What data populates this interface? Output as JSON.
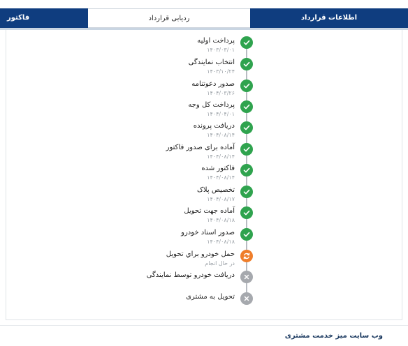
{
  "tabs": {
    "info": "اطلاعات قرارداد",
    "tracking": "ردیابی قرارداد",
    "invoice": "فاکتور"
  },
  "steps": [
    {
      "title": "پرداخت اولیه",
      "date": "۱۴۰۳/۰۳/۰۱",
      "status": "done"
    },
    {
      "title": "انتخاب نمایندگی",
      "date": "۱۴۰۳/۱۰/۲۴",
      "status": "done"
    },
    {
      "title": "صدور دعوتنامه",
      "date": "۱۴۰۴/۰۳/۲۶",
      "status": "done"
    },
    {
      "title": "پرداخت کل وجه",
      "date": "۱۴۰۴/۰۴/۰۱",
      "status": "done"
    },
    {
      "title": "دریافت پرونده",
      "date": "۱۴۰۴/۰۸/۱۴",
      "status": "done"
    },
    {
      "title": "آماده برای صدور فاکتور",
      "date": "۱۴۰۴/۰۸/۱۴",
      "status": "done"
    },
    {
      "title": "فاکتور شده",
      "date": "۱۴۰۴/۰۸/۱۴",
      "status": "done"
    },
    {
      "title": "تخصیص پلاک",
      "date": "۱۴۰۴/۰۸/۱۷",
      "status": "done"
    },
    {
      "title": "آماده جهت تحویل",
      "date": "۱۴۰۴/۰۸/۱۸",
      "status": "done"
    },
    {
      "title": "صدور اسناد خودرو",
      "date": "۱۴۰۴/۰۸/۱۸",
      "status": "done"
    },
    {
      "title": "حمل خودرو براي تحويل",
      "date": "در حال انجام",
      "status": "in-progress"
    },
    {
      "title": "دریافت خودرو توسط نمایندگی",
      "date": "",
      "status": "pending"
    },
    {
      "title": "تحویل به مشتری",
      "date": "",
      "status": "pending"
    }
  ],
  "colors": {
    "done": "#2fa34e",
    "in_progress": "#ef7e2b",
    "pending": "#a6a9ae",
    "tab_active": "#0f3d7f"
  },
  "footer": {
    "title": "وب سایت میز خدمت مشتری"
  }
}
